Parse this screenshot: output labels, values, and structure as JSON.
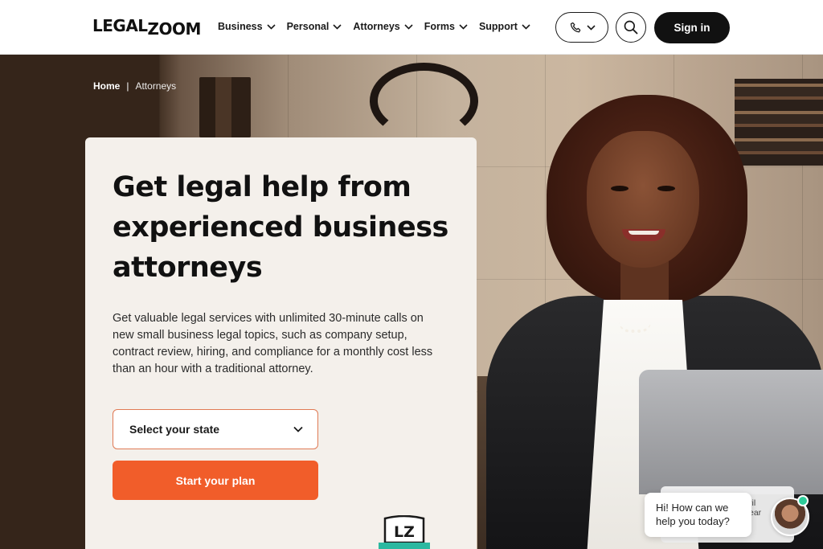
{
  "header": {
    "logo": {
      "part1": "LEGAL",
      "part2": "ZOOM"
    },
    "nav": [
      {
        "label": "Business"
      },
      {
        "label": "Personal"
      },
      {
        "label": "Attorneys"
      },
      {
        "label": "Forms"
      },
      {
        "label": "Support"
      }
    ],
    "phone_icon": "phone-icon",
    "search_icon": "search-icon",
    "signin_label": "Sign in"
  },
  "breadcrumb": {
    "home": "Home",
    "separator": "|",
    "current": "Attorneys"
  },
  "hero": {
    "title": "Get legal help from experienced business attorneys",
    "description": "Get valuable legal services with unlimited 30-minute calls on new small business legal topics, such as company setup, contract review, hiring, and compliance for a monthly cost less than an hour with a traditional attorney.",
    "state_select": {
      "placeholder": "Select your state"
    },
    "cta_label": "Start your plan",
    "badge_text": "LZ"
  },
  "chat": {
    "message": "Hi! How can we help you today?",
    "bg_text_1": "ril",
    "bg_text_2": "ear"
  },
  "colors": {
    "accent": "#f15d2a",
    "dark": "#111111",
    "card_bg": "#f4f0eb",
    "online": "#2ecc9a"
  }
}
